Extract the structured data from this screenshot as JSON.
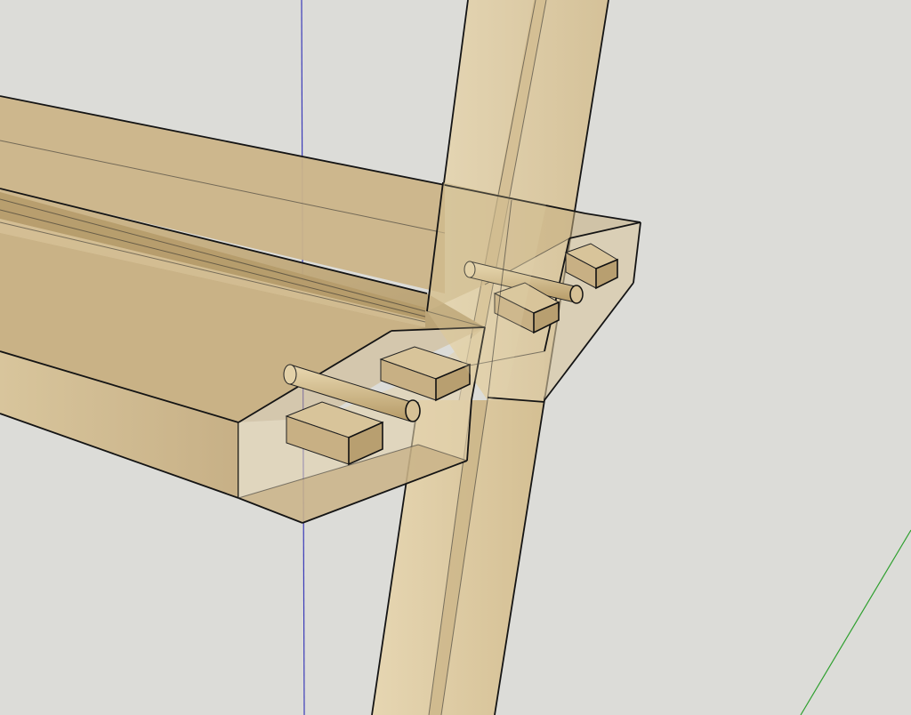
{
  "app": {
    "type": "3d-modeling-viewport",
    "view_mode": "x-ray"
  },
  "scene": {
    "background_color": "#dcdcd8",
    "axes": {
      "blue_axis_color": "#3b3bb8",
      "green_axis_color": "#2fa02f"
    },
    "model": {
      "description_label": "",
      "wood_color": "#d2b98a",
      "wood_dark_color": "#a98f5f",
      "wood_light_color": "#e8d8b4",
      "edge_color": "#141414",
      "parts": [
        "shelf-board",
        "angled-leg",
        "end-cap-block",
        "dowel-pins",
        "mortises"
      ]
    }
  }
}
